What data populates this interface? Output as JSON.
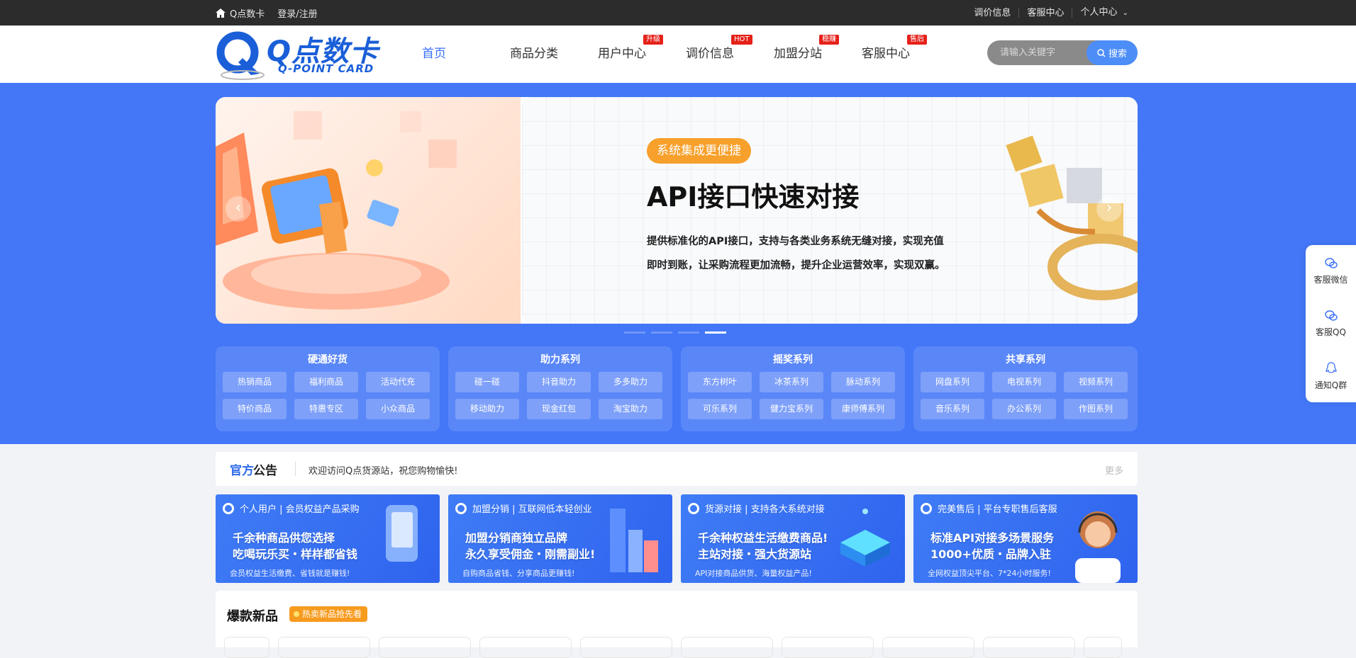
{
  "topbar": {
    "site_name": "Q点数卡",
    "login": "登录/注册",
    "links": [
      "调价信息",
      "客服中心",
      "个人中心"
    ]
  },
  "header": {
    "logo_text": "Q点数卡",
    "logo_sub": "Q-POINT CARD",
    "nav": [
      {
        "label": "首页",
        "tag": ""
      },
      {
        "label": "商品分类",
        "tag": ""
      },
      {
        "label": "用户中心",
        "tag": "升级"
      },
      {
        "label": "调价信息",
        "tag": "HOT"
      },
      {
        "label": "加盟分站",
        "tag": "稳赚"
      },
      {
        "label": "客服中心",
        "tag": "售后"
      }
    ],
    "search_placeholder": "请输入关键字",
    "search_button": "搜索"
  },
  "hero": {
    "pill": "系统集成更便捷",
    "title": "API接口快速对接",
    "desc_line1": "提供标准化的API接口，支持与各类业务系统无缝对接，实现充值",
    "desc_line2": "即时到账，让采购流程更加流畅，提升企业运营效率，实现双赢。",
    "prev": "‹",
    "next": "›",
    "slide_count": 4,
    "active_slide": 4
  },
  "categories": [
    {
      "title": "硬通好货",
      "items": [
        "热销商品",
        "福利商品",
        "活动代充",
        "特价商品",
        "特惠专区",
        "小众商品"
      ]
    },
    {
      "title": "助力系列",
      "items": [
        "碰一碰",
        "抖音助力",
        "多多助力",
        "移动助力",
        "现金红包",
        "淘宝助力"
      ]
    },
    {
      "title": "摇奖系列",
      "items": [
        "东方树叶",
        "冰茶系列",
        "脉动系列",
        "可乐系列",
        "健力宝系列",
        "康师傅系列"
      ]
    },
    {
      "title": "共享系列",
      "items": [
        "网盘系列",
        "电视系列",
        "视频系列",
        "音乐系列",
        "办公系列",
        "作图系列"
      ]
    }
  ],
  "notice": {
    "title_a": "官方",
    "title_b": "公告",
    "message": "欢迎访问Q点货源站，祝您购物愉快!",
    "more": "更多"
  },
  "banners": [
    {
      "cap": "个人用户 | 会员权益产品采购",
      "h1": "千余种商品供您选择",
      "h2": "吃喝玩乐买・样样都省钱",
      "sub": "会员权益生活缴费、省钱就是赚钱!"
    },
    {
      "cap": "加盟分销 | 互联网低本轻创业",
      "h1": "加盟分销商独立品牌",
      "h2": "永久享受佣金・刚需副业!",
      "sub": "自购商品省钱、分享商品更赚钱!"
    },
    {
      "cap": "货源对接 | 支持各大系统对接",
      "h1": "千余种权益生活缴费商品!",
      "h2": "主站对接・强大货源站",
      "sub": "API对接商品供货、海量权益产品!"
    },
    {
      "cap": "完美售后 | 平台专职售后客服",
      "h1": "标准API对接多场景服务",
      "h2": "1000+优质・品牌入驻",
      "sub": "全网权益顶尖平台、7*24小时服务!"
    }
  ],
  "hot": {
    "title": "爆款新品",
    "badge": "热卖新品抢先看"
  },
  "sidebar": {
    "items": [
      "客服微信",
      "客服QQ",
      "通知Q群"
    ]
  },
  "colors": {
    "brand": "#4377f7",
    "nav_active": "#3a6ff7",
    "tag_red": "#e5211a",
    "pill_orange": "#f7a02b"
  }
}
